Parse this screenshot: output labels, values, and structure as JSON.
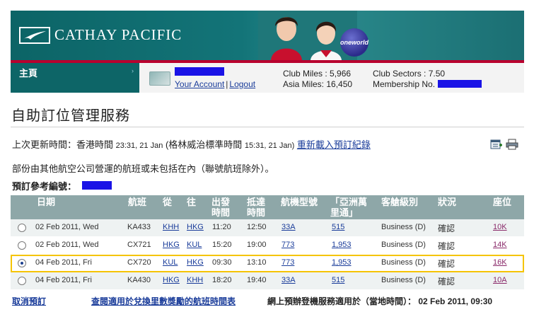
{
  "banner": {
    "brand": "CATHAY PACIFIC",
    "badge": "oneworld"
  },
  "nav": {
    "main_label": "主頁"
  },
  "account": {
    "your_account": "Your Account",
    "separator": "|",
    "logout": "Logout",
    "club_miles": "Club Miles : 5,966",
    "asia_miles": "Asia Miles: 16,450",
    "club_sectors": "Club Sectors : 7.50",
    "membership_no": "Membership No. :"
  },
  "page": {
    "title": "自助訂位管理服務",
    "updated_prefix": "上次更新時間：香港時間",
    "updated_hk": "23:31, 21 Jan",
    "updated_gmt_prefix": "(格林威治標準時間",
    "updated_gmt": "15:31, 21 Jan)",
    "reload_link": "重新載入預訂紀錄",
    "note": "部份由其他航空公司營運的航班或未包括在內（聯號航班除外）。",
    "ref_label": "預訂參考編號："
  },
  "table": {
    "headers": {
      "date": "日期",
      "flight": "航班",
      "from": "從",
      "to": "往",
      "dep": [
        "出發",
        "時間"
      ],
      "arr": [
        "抵達",
        "時間"
      ],
      "aircraft": "航機型號",
      "miles": [
        "「亞洲萬",
        "里通」"
      ],
      "class": "客艙級別",
      "status": "狀況",
      "seat": "座位"
    },
    "rows": [
      {
        "selected": false,
        "date": "02 Feb 2011, Wed",
        "flight": "KA433",
        "from": "KHH",
        "to": "HKG",
        "dep": "11:20",
        "arr": "12:50",
        "aircraft": "33A",
        "miles": "515",
        "cabin": "Business (D)",
        "status": "確認",
        "seat": "10K"
      },
      {
        "selected": false,
        "date": "02 Feb 2011, Wed",
        "flight": "CX721",
        "from": "HKG",
        "to": "KUL",
        "dep": "15:20",
        "arr": "19:00",
        "aircraft": "773",
        "miles": "1,953",
        "cabin": "Business (D)",
        "status": "確認",
        "seat": "14K"
      },
      {
        "selected": true,
        "date": "04 Feb 2011, Fri",
        "flight": "CX720",
        "from": "KUL",
        "to": "HKG",
        "dep": "09:30",
        "arr": "13:10",
        "aircraft": "773",
        "miles": "1,953",
        "cabin": "Business (D)",
        "status": "確認",
        "seat": "16K"
      },
      {
        "selected": false,
        "date": "04 Feb 2011, Fri",
        "flight": "KA430",
        "from": "HKG",
        "to": "KHH",
        "dep": "18:20",
        "arr": "19:40",
        "aircraft": "33A",
        "miles": "515",
        "cabin": "Business (D)",
        "status": "確認",
        "seat": "10A"
      }
    ]
  },
  "footer": {
    "cancel": "取消預訂",
    "timetable": "查閱適用於兌換里數獎勵的航班時間表",
    "online": "網上預辦登機服務適用於（當地時間）：",
    "online_time": "02 Feb 2011, 09:30"
  },
  "colors": {
    "accent": "#b8002e",
    "brand_teal": "#0d6567",
    "header_bg": "#8ea7a8",
    "link": "#1a3c9a",
    "selected_outline": "#f5c400"
  },
  "icons": [
    "cathay-logo-icon",
    "chevron-right-icon",
    "membership-card-icon",
    "calendar-add-icon",
    "printer-icon",
    "radio-button"
  ]
}
